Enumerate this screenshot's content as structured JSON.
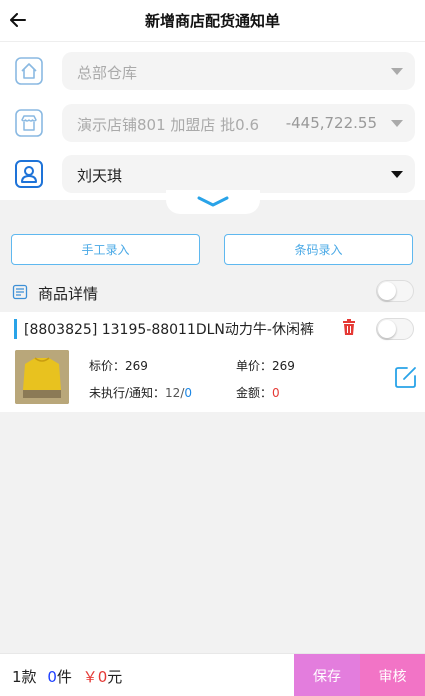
{
  "header": {
    "title": "新增商店配货通知单",
    "back_icon": "arrow-left-icon"
  },
  "form": {
    "warehouse": {
      "placeholder": "总部仓库",
      "icon": "home-icon"
    },
    "store": {
      "value": "演示店铺801 加盟店 批0.6",
      "balance": "-445,722.55",
      "icon": "store-icon"
    },
    "person": {
      "value": "刘天琪",
      "icon": "person-icon"
    }
  },
  "actions": {
    "manual_entry": "手工录入",
    "barcode_entry": "条码录入"
  },
  "detail": {
    "label": "商品详情",
    "toggle_on": false
  },
  "product": {
    "name": "[8803825] 13195-88011DLN动力牛-休闲裤",
    "toggle_on": false,
    "tag_price_label": "标价：",
    "tag_price": "269",
    "unit_price_label": "单价：",
    "unit_price": "269",
    "pending_label": "未执行/通知：",
    "pending": "12/",
    "notified": "0",
    "amount_label": "金额：",
    "amount": "0"
  },
  "footer": {
    "kinds": "1款",
    "qty_num": "0",
    "qty_unit": "件",
    "currency": "￥",
    "total": "0",
    "total_unit": "元",
    "save": "保存",
    "audit": "审核"
  },
  "colors": {
    "accent": "#29a3e8",
    "save": "#e37ddd",
    "audit": "#f274c6"
  }
}
